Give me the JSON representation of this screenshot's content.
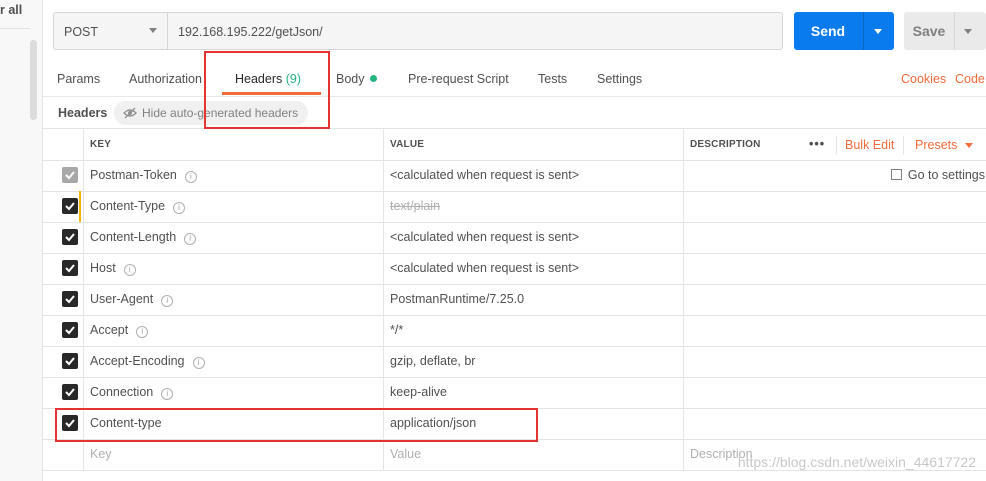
{
  "sidebar": {
    "clear_all": "r all"
  },
  "request": {
    "method": "POST",
    "url": "192.168.195.222/getJson/",
    "send_label": "Send",
    "save_label": "Save"
  },
  "tabs": {
    "params": "Params",
    "authorization": "Authorization",
    "headers": "Headers",
    "headers_count": "(9)",
    "body": "Body",
    "prerequest": "Pre-request Script",
    "tests": "Tests",
    "settings": "Settings",
    "cookies": "Cookies",
    "code": "Code"
  },
  "headers_bar": {
    "title": "Headers",
    "hide_auto": "Hide auto-generated headers"
  },
  "table": {
    "col_key": "KEY",
    "col_value": "VALUE",
    "col_description": "DESCRIPTION",
    "more": "•••",
    "bulk_edit": "Bulk Edit",
    "presets": "Presets",
    "go_to_settings": "Go to settings",
    "rows": [
      {
        "key": "Postman-Token",
        "value": "<calculated when request is sent>"
      },
      {
        "key": "Content-Type",
        "value": "text/plain"
      },
      {
        "key": "Content-Length",
        "value": "<calculated when request is sent>"
      },
      {
        "key": "Host",
        "value": "<calculated when request is sent>"
      },
      {
        "key": "User-Agent",
        "value": "PostmanRuntime/7.25.0"
      },
      {
        "key": "Accept",
        "value": "*/*"
      },
      {
        "key": "Accept-Encoding",
        "value": "gzip, deflate, br"
      },
      {
        "key": "Connection",
        "value": "keep-alive"
      },
      {
        "key": "Content-type",
        "value": "application/json"
      }
    ],
    "placeholder_key": "Key",
    "placeholder_value": "Value",
    "placeholder_description": "Description"
  },
  "watermark": "https://blog.csdn.net/weixin_44617722",
  "colors": {
    "accent": "#f26b3a",
    "send": "#097bed",
    "active_count": "#26b47f",
    "annotation": "#e53333"
  }
}
